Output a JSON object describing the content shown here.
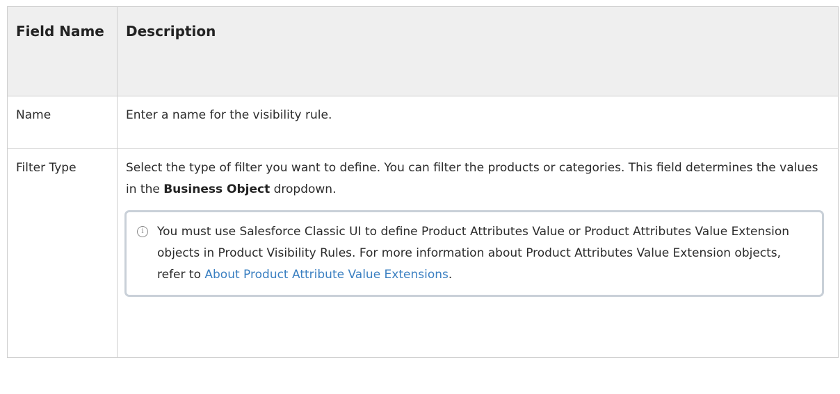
{
  "table": {
    "headers": {
      "field_name": "Field Name",
      "description": "Description"
    },
    "rows": [
      {
        "field": "Name",
        "description": "Enter a name for the visibility rule."
      },
      {
        "field": "Filter Type",
        "description_before": "Select the type of filter you want to define. You can filter the products or categories. This field determines the values in the ",
        "description_bold": "Business Object",
        "description_after": " dropdown.",
        "note": {
          "icon": "info-icon",
          "text": "You must use Salesforce Classic UI to define Product Attributes Value or Product Attributes Value Extension objects in Product Visibility Rules. For more information about Product Attributes Value Extension objects, refer to ",
          "link_text": "About Product Attribute Value Extensions",
          "text_after": "."
        }
      }
    ]
  },
  "colors": {
    "header_bg": "#efefef",
    "border": "#cfcfcf",
    "note_border": "#c9d0d8",
    "link": "#3a7fc1"
  }
}
